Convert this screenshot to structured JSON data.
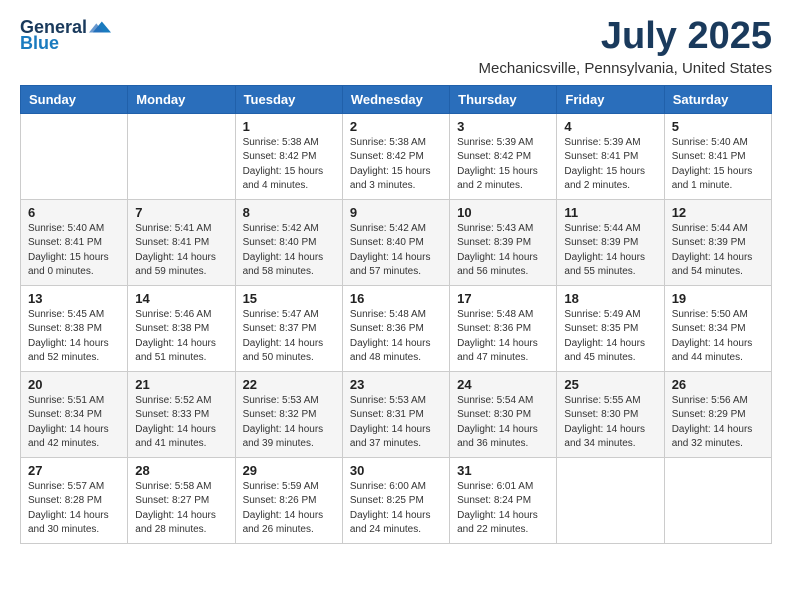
{
  "logo": {
    "general": "General",
    "blue": "Blue"
  },
  "title": "July 2025",
  "location": "Mechanicsville, Pennsylvania, United States",
  "days_of_week": [
    "Sunday",
    "Monday",
    "Tuesday",
    "Wednesday",
    "Thursday",
    "Friday",
    "Saturday"
  ],
  "weeks": [
    [
      {
        "day": "",
        "info": ""
      },
      {
        "day": "",
        "info": ""
      },
      {
        "day": "1",
        "info": "Sunrise: 5:38 AM\nSunset: 8:42 PM\nDaylight: 15 hours and 4 minutes."
      },
      {
        "day": "2",
        "info": "Sunrise: 5:38 AM\nSunset: 8:42 PM\nDaylight: 15 hours and 3 minutes."
      },
      {
        "day": "3",
        "info": "Sunrise: 5:39 AM\nSunset: 8:42 PM\nDaylight: 15 hours and 2 minutes."
      },
      {
        "day": "4",
        "info": "Sunrise: 5:39 AM\nSunset: 8:41 PM\nDaylight: 15 hours and 2 minutes."
      },
      {
        "day": "5",
        "info": "Sunrise: 5:40 AM\nSunset: 8:41 PM\nDaylight: 15 hours and 1 minute."
      }
    ],
    [
      {
        "day": "6",
        "info": "Sunrise: 5:40 AM\nSunset: 8:41 PM\nDaylight: 15 hours and 0 minutes."
      },
      {
        "day": "7",
        "info": "Sunrise: 5:41 AM\nSunset: 8:41 PM\nDaylight: 14 hours and 59 minutes."
      },
      {
        "day": "8",
        "info": "Sunrise: 5:42 AM\nSunset: 8:40 PM\nDaylight: 14 hours and 58 minutes."
      },
      {
        "day": "9",
        "info": "Sunrise: 5:42 AM\nSunset: 8:40 PM\nDaylight: 14 hours and 57 minutes."
      },
      {
        "day": "10",
        "info": "Sunrise: 5:43 AM\nSunset: 8:39 PM\nDaylight: 14 hours and 56 minutes."
      },
      {
        "day": "11",
        "info": "Sunrise: 5:44 AM\nSunset: 8:39 PM\nDaylight: 14 hours and 55 minutes."
      },
      {
        "day": "12",
        "info": "Sunrise: 5:44 AM\nSunset: 8:39 PM\nDaylight: 14 hours and 54 minutes."
      }
    ],
    [
      {
        "day": "13",
        "info": "Sunrise: 5:45 AM\nSunset: 8:38 PM\nDaylight: 14 hours and 52 minutes."
      },
      {
        "day": "14",
        "info": "Sunrise: 5:46 AM\nSunset: 8:38 PM\nDaylight: 14 hours and 51 minutes."
      },
      {
        "day": "15",
        "info": "Sunrise: 5:47 AM\nSunset: 8:37 PM\nDaylight: 14 hours and 50 minutes."
      },
      {
        "day": "16",
        "info": "Sunrise: 5:48 AM\nSunset: 8:36 PM\nDaylight: 14 hours and 48 minutes."
      },
      {
        "day": "17",
        "info": "Sunrise: 5:48 AM\nSunset: 8:36 PM\nDaylight: 14 hours and 47 minutes."
      },
      {
        "day": "18",
        "info": "Sunrise: 5:49 AM\nSunset: 8:35 PM\nDaylight: 14 hours and 45 minutes."
      },
      {
        "day": "19",
        "info": "Sunrise: 5:50 AM\nSunset: 8:34 PM\nDaylight: 14 hours and 44 minutes."
      }
    ],
    [
      {
        "day": "20",
        "info": "Sunrise: 5:51 AM\nSunset: 8:34 PM\nDaylight: 14 hours and 42 minutes."
      },
      {
        "day": "21",
        "info": "Sunrise: 5:52 AM\nSunset: 8:33 PM\nDaylight: 14 hours and 41 minutes."
      },
      {
        "day": "22",
        "info": "Sunrise: 5:53 AM\nSunset: 8:32 PM\nDaylight: 14 hours and 39 minutes."
      },
      {
        "day": "23",
        "info": "Sunrise: 5:53 AM\nSunset: 8:31 PM\nDaylight: 14 hours and 37 minutes."
      },
      {
        "day": "24",
        "info": "Sunrise: 5:54 AM\nSunset: 8:30 PM\nDaylight: 14 hours and 36 minutes."
      },
      {
        "day": "25",
        "info": "Sunrise: 5:55 AM\nSunset: 8:30 PM\nDaylight: 14 hours and 34 minutes."
      },
      {
        "day": "26",
        "info": "Sunrise: 5:56 AM\nSunset: 8:29 PM\nDaylight: 14 hours and 32 minutes."
      }
    ],
    [
      {
        "day": "27",
        "info": "Sunrise: 5:57 AM\nSunset: 8:28 PM\nDaylight: 14 hours and 30 minutes."
      },
      {
        "day": "28",
        "info": "Sunrise: 5:58 AM\nSunset: 8:27 PM\nDaylight: 14 hours and 28 minutes."
      },
      {
        "day": "29",
        "info": "Sunrise: 5:59 AM\nSunset: 8:26 PM\nDaylight: 14 hours and 26 minutes."
      },
      {
        "day": "30",
        "info": "Sunrise: 6:00 AM\nSunset: 8:25 PM\nDaylight: 14 hours and 24 minutes."
      },
      {
        "day": "31",
        "info": "Sunrise: 6:01 AM\nSunset: 8:24 PM\nDaylight: 14 hours and 22 minutes."
      },
      {
        "day": "",
        "info": ""
      },
      {
        "day": "",
        "info": ""
      }
    ]
  ]
}
